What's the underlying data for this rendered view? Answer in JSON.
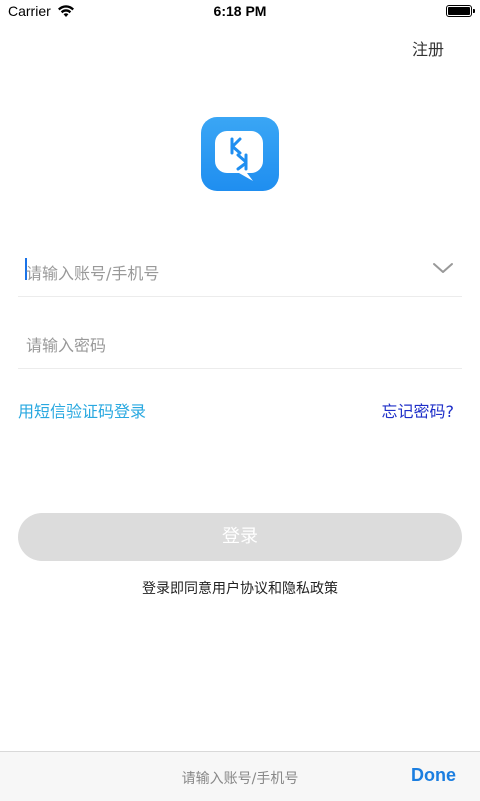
{
  "status_bar": {
    "carrier": "Carrier",
    "time": "6:18 PM"
  },
  "header": {
    "register_label": "注册"
  },
  "logo": {
    "letters": "KK"
  },
  "account_field": {
    "placeholder": "请输入账号/手机号"
  },
  "password_field": {
    "placeholder": "请输入密码"
  },
  "links": {
    "sms_login": "用短信验证码登录",
    "forgot_password": "忘记密码?"
  },
  "login_button": {
    "label": "登录"
  },
  "agreement_text": "登录即同意用户协议和隐私政策",
  "keyboard_accessory": {
    "hint": "请输入账号/手机号",
    "done_label": "Done"
  },
  "colors": {
    "accent": "#1b7ee0",
    "sms_link": "#28a8e0",
    "forgot_link": "#1e2fc8",
    "button_disabled": "#dcdcdc",
    "logo_blue": "#1f8ef0"
  }
}
